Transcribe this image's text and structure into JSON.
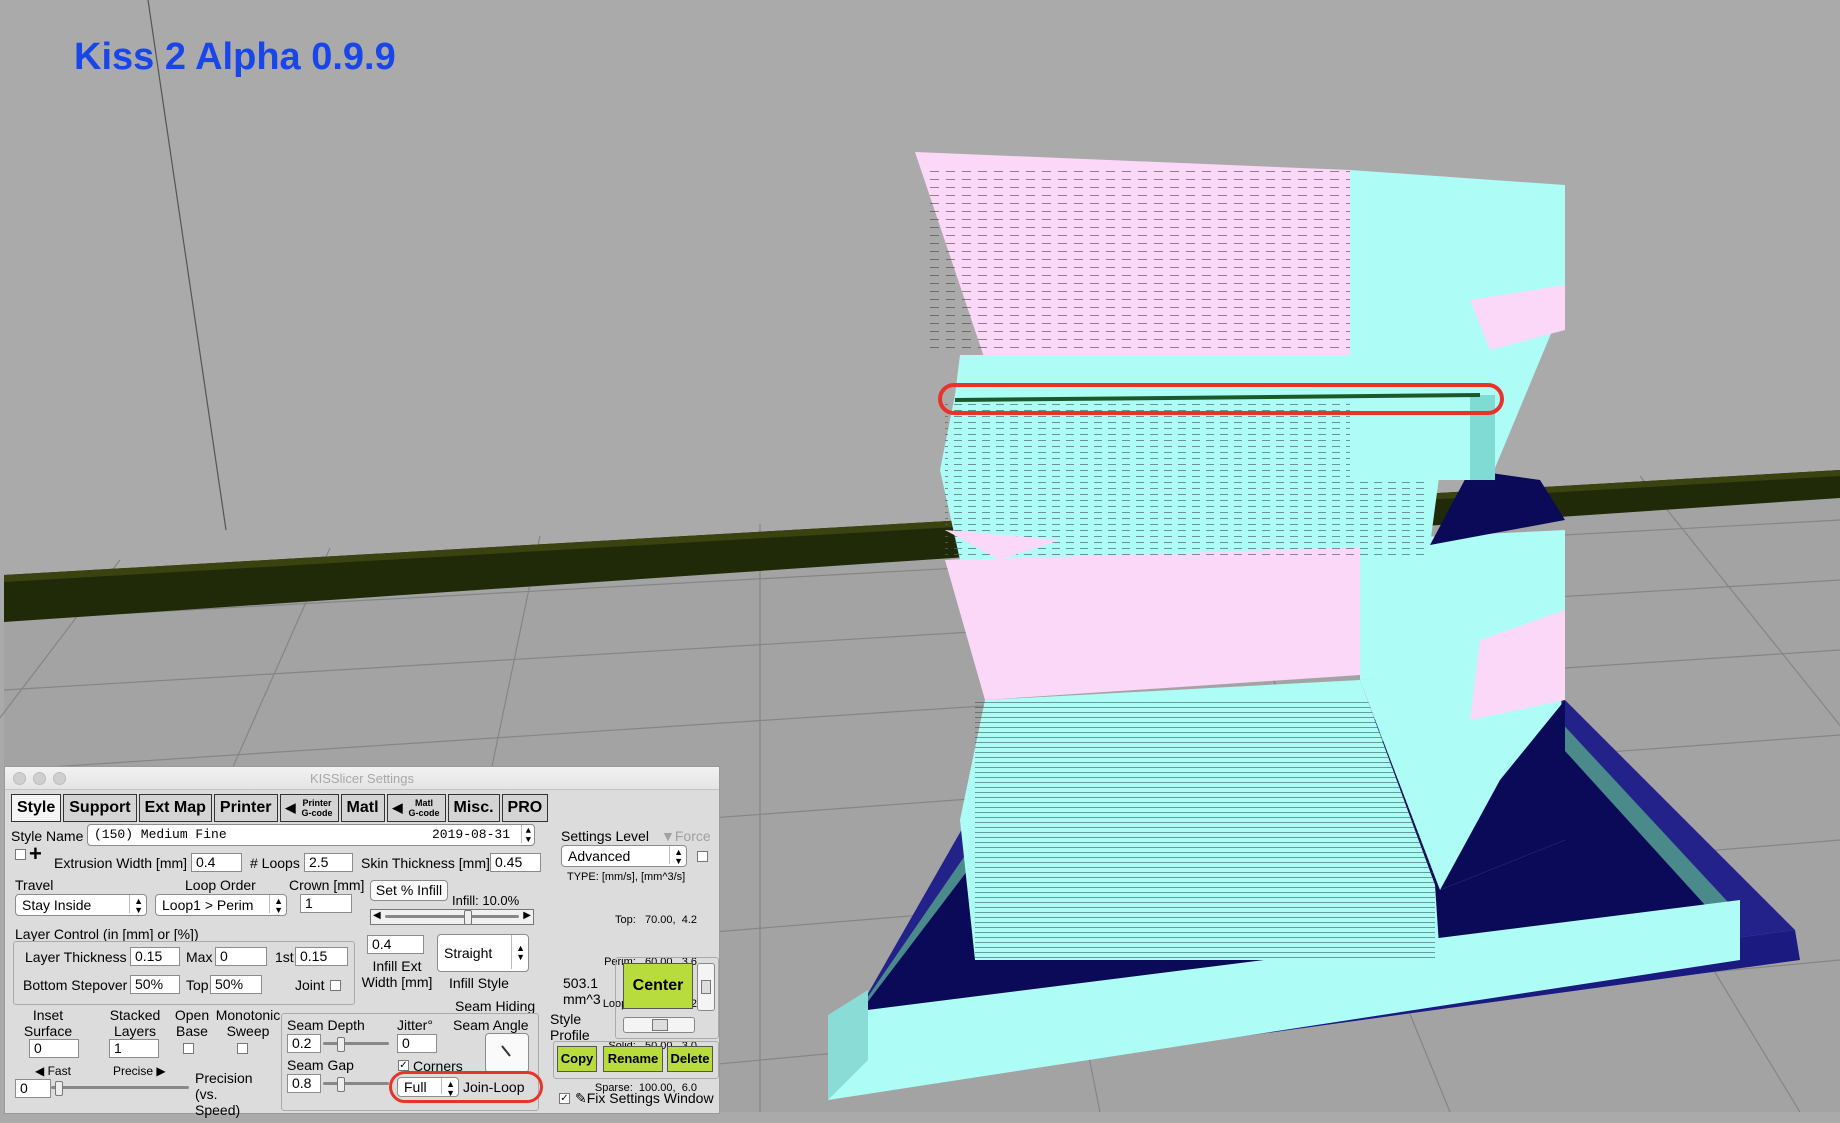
{
  "app": {
    "title": "Kiss 2 Alpha 0.9.9"
  },
  "window": {
    "title": "KISSlicer Settings"
  },
  "tabs": [
    {
      "label": "Style"
    },
    {
      "label": "Support"
    },
    {
      "label": "Ext Map"
    },
    {
      "label": "Printer"
    },
    {
      "label": "Printer",
      "sub": "G-code"
    },
    {
      "label": "Matl"
    },
    {
      "label": "Matl",
      "sub": "G-code"
    },
    {
      "label": "Misc."
    },
    {
      "label": "PRO"
    }
  ],
  "style_name": {
    "label": "Style Name",
    "value": "(150) Medium Fine",
    "date": "2019-08-31"
  },
  "extrusion": {
    "label": "Extrusion Width [mm]",
    "value": "0.4",
    "loops_label": "# Loops",
    "loops": "2.5",
    "skin_label": "Skin Thickness [mm]",
    "skin": "0.45"
  },
  "travel": {
    "label": "Travel",
    "value": "Stay Inside"
  },
  "loop_order": {
    "label": "Loop Order",
    "value": "Loop1 > Perim"
  },
  "crown": {
    "label": "Crown [mm]",
    "value": "1"
  },
  "infill": {
    "set_label": "Set % Infill",
    "percent_label": "Infill: 10.0%",
    "ext_width": "0.4",
    "ext_width_label": "Infill Ext Width [mm]",
    "style": "Straight",
    "style_label": "Infill Style"
  },
  "layer_control": {
    "label": "Layer Control (in [mm] or [%])",
    "thickness_label": "Layer Thickness",
    "thickness": "0.15",
    "max_label": "Max",
    "max": "0",
    "first_label": "1st",
    "first": "0.15",
    "bottom_label": "Bottom Stepover",
    "bottom": "50%",
    "top_label": "Top",
    "top": "50%",
    "joint_label": "Joint"
  },
  "inset": {
    "label": "Inset Surface [mm]",
    "value": "0"
  },
  "stacked": {
    "label": "Stacked Layers",
    "value": "1"
  },
  "open_base": {
    "label": "Open Base"
  },
  "monotonic": {
    "label": "Monotonic Sweep"
  },
  "precision": {
    "fast": "Fast",
    "precise": "Precise",
    "value": "0",
    "label": "Precision (vs. Speed)"
  },
  "seam": {
    "hiding_label": "Seam Hiding",
    "depth_label": "Seam Depth",
    "depth": "0.2",
    "jitter_label": "Jitter°",
    "jitter": "0",
    "angle_label": "Seam Angle",
    "gap_label": "Seam Gap",
    "gap": "0.8",
    "corners_label": "Corners",
    "mode": "Full",
    "join_label": "Join-Loop"
  },
  "settings_level": {
    "label": "Settings Level",
    "force_label": "Force",
    "value": "Advanced"
  },
  "speeds": {
    "header": "TYPE: [mm/s], [mm^3/s]",
    "rows": [
      "Top:   70.00,  4.2",
      "Perim:   60.00,  3.6",
      "Loops:   70.00,  4.2",
      "Solid:   50.00,  3.0",
      "Sparse:  100.00,  6.0"
    ]
  },
  "volume": {
    "value": "503.1",
    "unit": "mm^3"
  },
  "style_profile": {
    "label": "Style Profile"
  },
  "center_button": "Center",
  "profile_buttons": {
    "copy": "Copy",
    "rename": "Rename",
    "delete": "Delete"
  },
  "fix_window": {
    "label": "Fix Settings Window"
  },
  "colors": {
    "title": "#1846e8",
    "model_cyan": "#aefcf6",
    "model_pink": "#fcd8f8",
    "bed_navy": "#1a1a80",
    "highlight": "#e8332b",
    "button_green": "#b8dc3c"
  }
}
